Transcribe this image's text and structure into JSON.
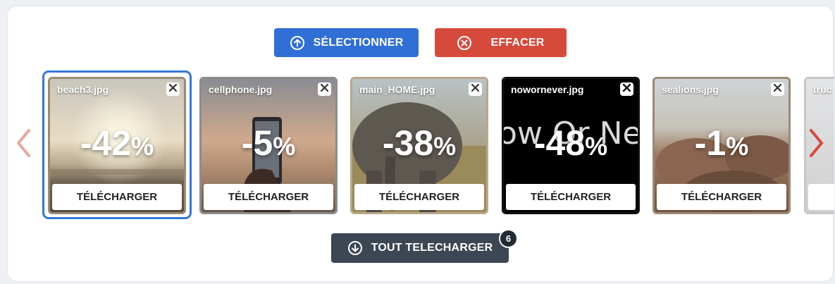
{
  "toolbar": {
    "select_label": "SÉLECTIONNER",
    "clear_label": "EFFACER",
    "download_all_label": "TOUT TELECHARGER",
    "download_all_count": "6",
    "select_color": "#2f6fd6",
    "clear_color": "#d64a3b",
    "download_all_color": "#3d4653"
  },
  "icons": {
    "select": "upload-circle-icon",
    "clear": "x-circle-icon",
    "download_all": "download-circle-icon",
    "prev": "chevron-left-icon",
    "next": "chevron-right-icon",
    "remove": "close-icon"
  },
  "files": [
    {
      "name": "beach3.jpg",
      "saving": "-42%",
      "download_label": "TÉLÉCHARGER",
      "selected": true
    },
    {
      "name": "cellphone.jpg",
      "saving": "-5%",
      "download_label": "TÉLÉCHARGER",
      "selected": false
    },
    {
      "name": "main_HOME.jpg",
      "saving": "-38%",
      "download_label": "TÉLÉCHARGER",
      "selected": false
    },
    {
      "name": "nowornever.jpg",
      "saving": "-48%",
      "download_label": "TÉLÉCHARGER",
      "selected": false
    },
    {
      "name": "sealions.jpg",
      "saving": "-1%",
      "download_label": "TÉLÉCHARGER",
      "selected": false
    },
    {
      "name": "truc",
      "saving": "",
      "download_label": "",
      "selected": false
    }
  ],
  "overlay_text": {
    "nowornever": "ow Or Neve"
  }
}
